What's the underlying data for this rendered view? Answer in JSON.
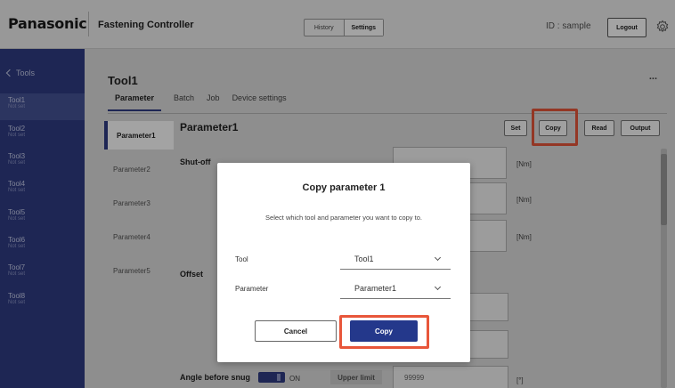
{
  "header": {
    "logo": "Panasonic",
    "app_title": "Fastening Controller",
    "history_label": "History",
    "settings_label": "Settings",
    "user_id": "ID : sample",
    "logout_label": "Logout",
    "settings_icon": "gear-icon"
  },
  "sidebar": {
    "back_label": "Tools",
    "items": [
      {
        "name": "Tool1",
        "status": "Not set"
      },
      {
        "name": "Tool2",
        "status": "Not set"
      },
      {
        "name": "Tool3",
        "status": "Not set"
      },
      {
        "name": "Tool4",
        "status": "Not set"
      },
      {
        "name": "Tool5",
        "status": "Not set"
      },
      {
        "name": "Tool6",
        "status": "Not set"
      },
      {
        "name": "Tool7",
        "status": "Not set"
      },
      {
        "name": "Tool8",
        "status": "Not set"
      }
    ]
  },
  "main": {
    "title": "Tool1",
    "more": "...",
    "tabs": [
      "Parameter",
      "Batch",
      "Job",
      "Device settings"
    ],
    "params": [
      "Parameter1",
      "Parameter2",
      "Parameter3",
      "Parameter4",
      "Parameter5"
    ],
    "content_title": "Parameter1",
    "actions": {
      "set": "Set",
      "copy": "Copy",
      "read": "Read",
      "output": "Output"
    },
    "fields": {
      "shutoff": "Shut-off",
      "offset": "Offset",
      "angle_before_snug": "Angle before snug",
      "on_label": "ON",
      "upper_limit": "Upper limit",
      "upper_value": "99999"
    },
    "units": [
      "[Nm]",
      "[Nm]",
      "[Nm]",
      "[°]"
    ]
  },
  "dialog": {
    "title": "Copy parameter 1",
    "message": "Select which tool and parameter you want to copy to.",
    "tool_label": "Tool",
    "tool_value": "Tool1",
    "param_label": "Parameter",
    "param_value": "Parameter1",
    "cancel_label": "Cancel",
    "copy_label": "Copy"
  },
  "colors": {
    "brand": "#2f3c84",
    "primary_button": "#24388b",
    "highlight": "#e8563a"
  }
}
